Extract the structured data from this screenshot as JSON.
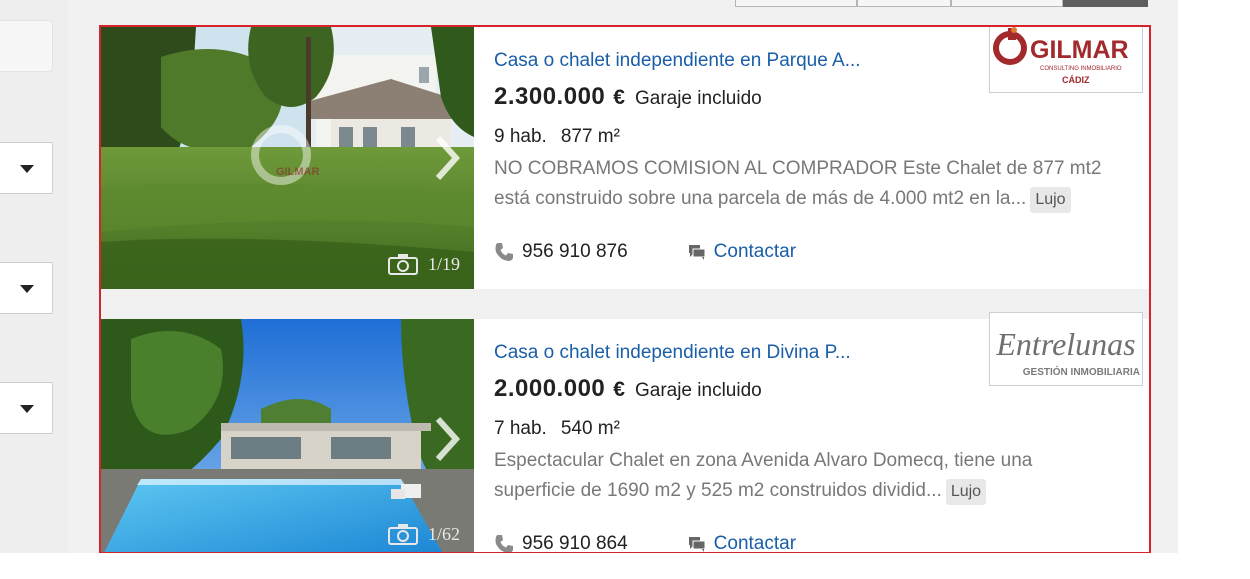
{
  "listings": [
    {
      "title": "Casa o chalet independiente en Parque A...",
      "price": "2.300.000",
      "currency": "€",
      "extra": "Garaje incluido",
      "rooms": "9 hab.",
      "area": "877 m²",
      "description": "NO COBRAMOS COMISION AL COMPRADOR Este Chalet de 877 mt2 está construido sobre una parcela de más de 4.000 mt2 en la...",
      "tag": "Lujo",
      "photo_counter": "1/19",
      "phone": "956 910 876",
      "contact_label": "Contactar",
      "agency_logo": {
        "name": "GILMAR",
        "subtitle": "CONSULTING INMOBILIARIO",
        "city": "CÁDIZ",
        "brand_color": "#a2292c"
      }
    },
    {
      "title": "Casa o chalet independiente en Divina P...",
      "price": "2.000.000",
      "currency": "€",
      "extra": "Garaje incluido",
      "rooms": "7 hab.",
      "area": "540 m²",
      "description": "Espectacular Chalet en zona Avenida Alvaro Domecq, tiene una superficie de 1690 m2 y 525 m2 construidos dividid...",
      "tag": "Lujo",
      "photo_counter": "1/62",
      "phone": "956 910 864",
      "contact_label": "Contactar",
      "agency_logo": {
        "name": "Entrelunas",
        "subtitle": "GESTIÓN INMOBILIARIA",
        "brand_color": "#6f6f6f"
      }
    }
  ],
  "colors": {
    "link": "#1a5ea8",
    "highlight_border": "#d9232a",
    "panel_bg": "#f1f1f1"
  },
  "icons": [
    "caret-down-icon",
    "camera-icon",
    "chevron-right-icon",
    "phone-icon",
    "chat-icon"
  ]
}
